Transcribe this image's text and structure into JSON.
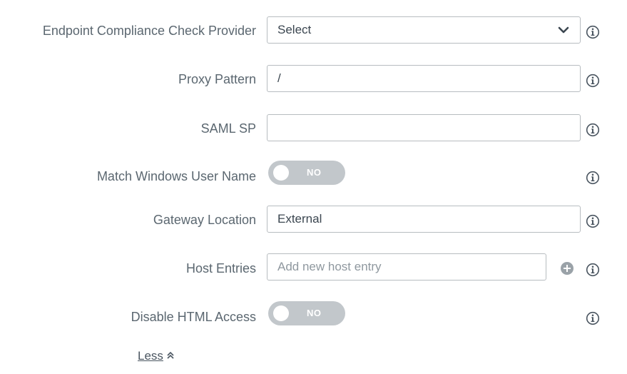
{
  "form": {
    "endpoint_provider": {
      "label": "Endpoint Compliance Check Provider",
      "value": "Select",
      "icon": "chevron-down-icon"
    },
    "proxy_pattern": {
      "label": "Proxy Pattern",
      "value": "/"
    },
    "saml_sp": {
      "label": "SAML SP",
      "value": ""
    },
    "match_windows_user_name": {
      "label": "Match Windows User Name",
      "toggle_text": "NO"
    },
    "gateway_location": {
      "label": "Gateway Location",
      "value": "External"
    },
    "host_entries": {
      "label": "Host Entries",
      "placeholder": "Add new host entry"
    },
    "disable_html_access": {
      "label": "Disable HTML Access",
      "toggle_text": "NO"
    },
    "less_link": "Less"
  },
  "colors": {
    "label_text": "#5b6770",
    "toggle_off": "#c2c7cb",
    "border": "#b7bcc0",
    "icon": "#4a5560"
  }
}
